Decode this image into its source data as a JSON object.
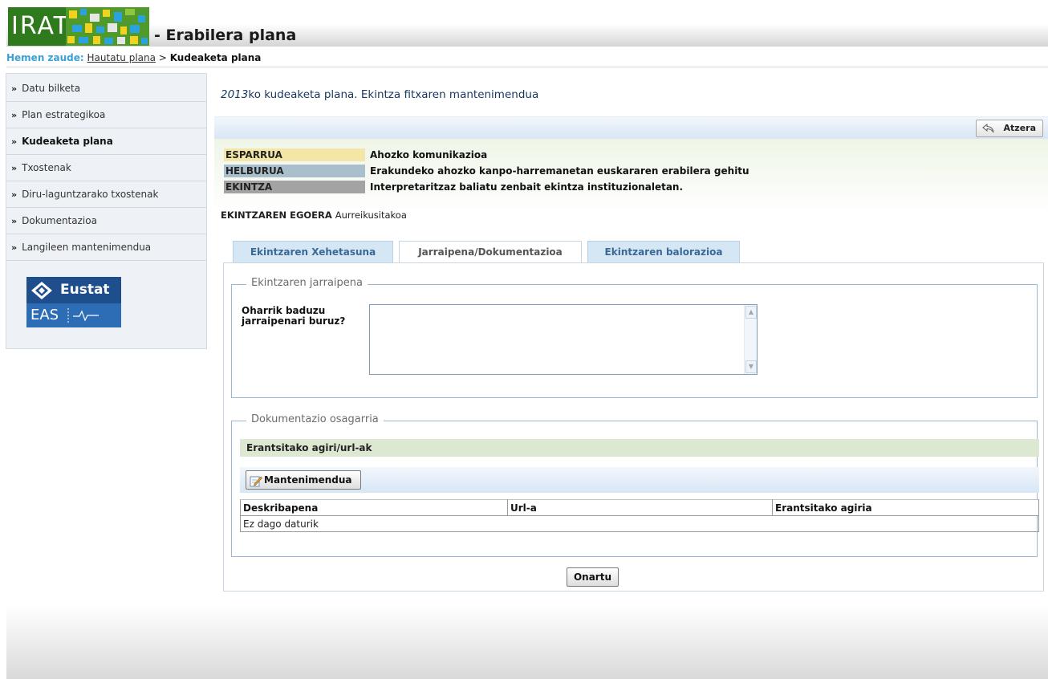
{
  "header": {
    "logo_text": "IRATI",
    "app_title": "- Erabilera plana"
  },
  "breadcrumb": {
    "label": "Hemen zaude:",
    "link": "Hautatu plana",
    "separator": ">",
    "current": "Kudeaketa plana"
  },
  "sidebar": {
    "items": [
      {
        "label": "Datu bilketa"
      },
      {
        "label": "Plan estrategikoa"
      },
      {
        "label": "Kudeaketa plana",
        "active": true
      },
      {
        "label": "Txostenak"
      },
      {
        "label": "Diru-laguntzarako txostenak"
      },
      {
        "label": "Dokumentazioa"
      },
      {
        "label": "Langileen mantenimendua"
      }
    ],
    "logo": {
      "top": "Eustat",
      "bottom": "EAS"
    }
  },
  "page": {
    "title_year": "2013",
    "title_rest": "ko kudeaketa plana. Ekintza fitxaren mantenimendua",
    "back_button": "Atzera"
  },
  "info": {
    "rows": [
      {
        "label": "ESPARRUA",
        "value": "Ahozko komunikazioa",
        "color": "#f3e6a6"
      },
      {
        "label": "HELBURUA",
        "value": "Erakundeko ahozko kanpo-harremanetan euskararen erabilera gehitu",
        "color": "#a9c0cc"
      },
      {
        "label": "EKINTZA",
        "value": "Interpretaritzaz baliatu zenbait ekintza instituzionaletan.",
        "color": "#a3a3a3"
      }
    ],
    "status_label": "EKINTZAREN EGOERA",
    "status_value": "Aurreikusitakoa"
  },
  "tabs": [
    {
      "label": "Ekintzaren Xehetasuna"
    },
    {
      "label": "Jarraipena/Dokumentazioa",
      "active": true
    },
    {
      "label": "Ekintzaren balorazioa"
    }
  ],
  "followup": {
    "legend": "Ekintzaren jarraipena",
    "notes_label": "Oharrik baduzu jarraipenari buruz?",
    "notes_value": ""
  },
  "documentation": {
    "legend": "Dokumentazio osagarria",
    "attached_header": "Erantsitako agiri/url-ak",
    "maintenance_button": "Mantenimendua",
    "columns": [
      "Deskribapena",
      "Url-a",
      "Erantsitako agiria"
    ],
    "empty_text": "Ez dago daturik"
  },
  "accept_button": "Onartu"
}
